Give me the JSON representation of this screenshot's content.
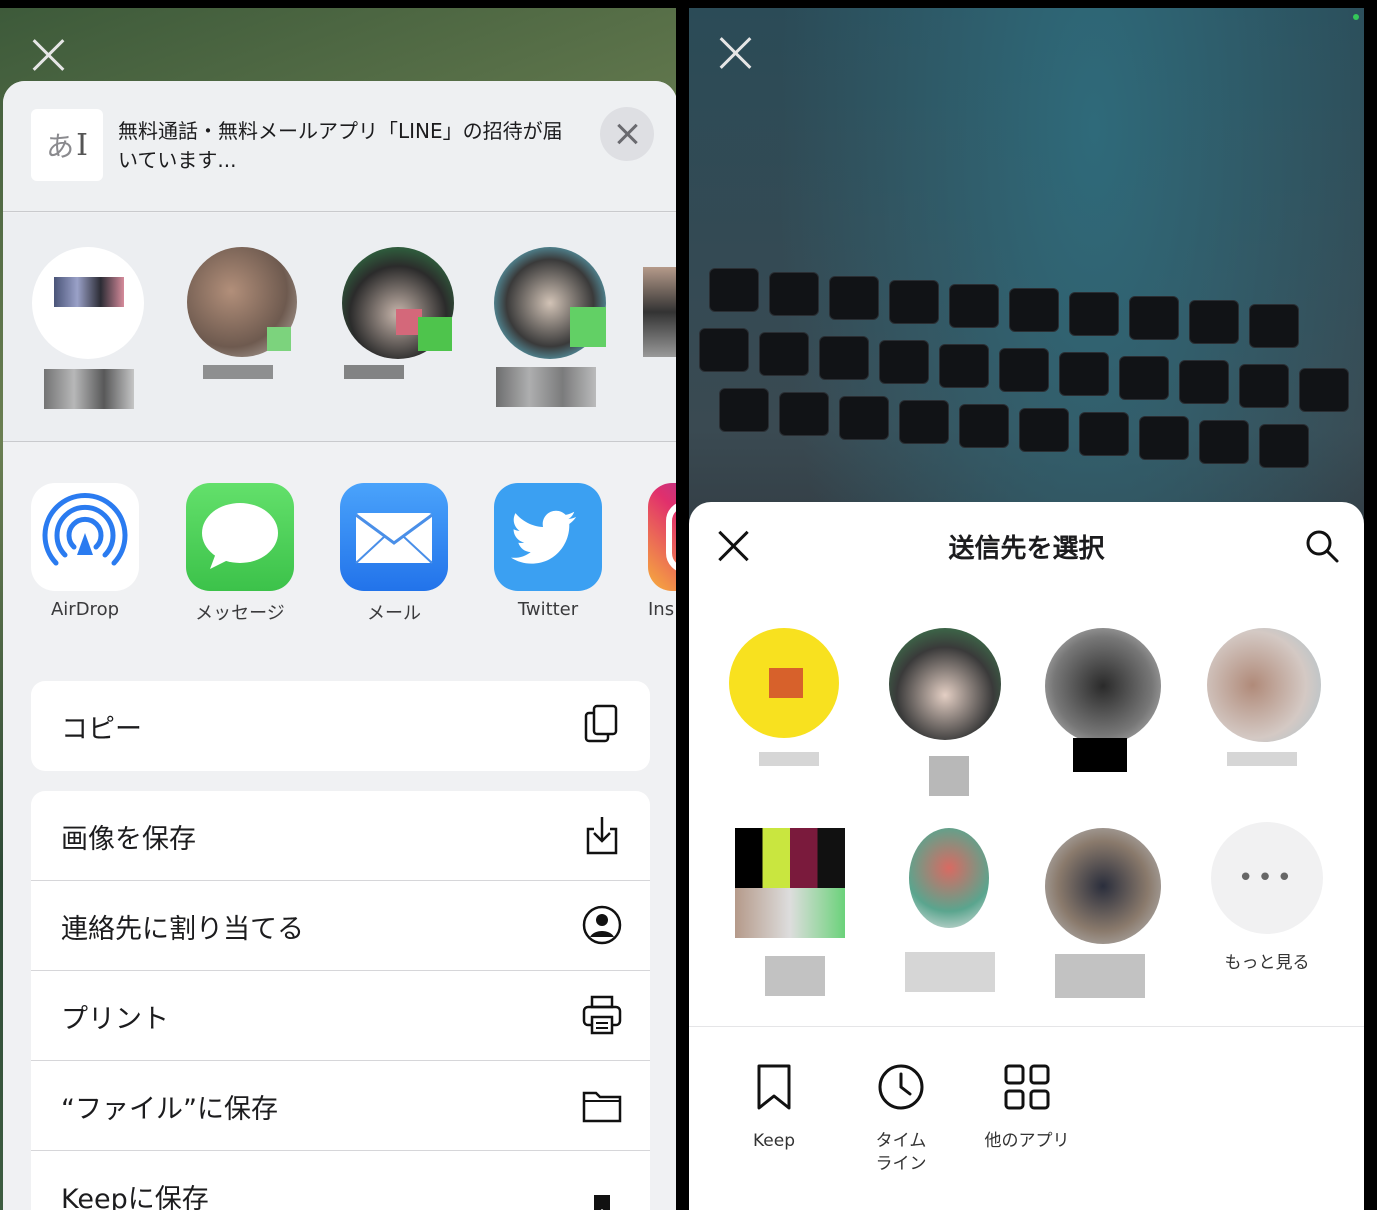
{
  "left": {
    "header": {
      "thumbnail_text": "あ",
      "title": "無料通話・無料メールアプリ「LINE」の招待が届いています..."
    },
    "people_row_count": 5,
    "apps": [
      {
        "label": "AirDrop",
        "icon": "airdrop-icon"
      },
      {
        "label": "メッセージ",
        "icon": "messages-icon"
      },
      {
        "label": "メール",
        "icon": "mail-icon"
      },
      {
        "label": "Twitter",
        "icon": "twitter-icon"
      },
      {
        "label": "Ins",
        "icon": "instagram-icon"
      }
    ],
    "actions": {
      "copy": {
        "label": "コピー",
        "icon": "copy-icon"
      },
      "save_image": {
        "label": "画像を保存",
        "icon": "download-icon"
      },
      "assign_contact": {
        "label": "連絡先に割り当てる",
        "icon": "contact-icon"
      },
      "print": {
        "label": "プリント",
        "icon": "printer-icon"
      },
      "save_files": {
        "label": "“ファイル”に保存",
        "icon": "folder-icon"
      },
      "save_keep": {
        "label": "Keepに保存",
        "icon": "bookmark-icon"
      }
    }
  },
  "right": {
    "title": "送信先を選択",
    "more_label": "もっと見る",
    "more_glyph": "•••",
    "destinations": [
      {
        "label": "Keep",
        "icon": "bookmark-icon"
      },
      {
        "label": "タイム\nライン",
        "icon": "clock-icon"
      },
      {
        "label": "他のアプリ",
        "icon": "grid-icon"
      }
    ]
  },
  "colors": {
    "messages_green": "#4cd964",
    "mail_blue": "#2f8cf7",
    "twitter_blue": "#3ba0f2",
    "airdrop_blue": "#2a7bf0",
    "line_yellow": "#f8e11f"
  }
}
